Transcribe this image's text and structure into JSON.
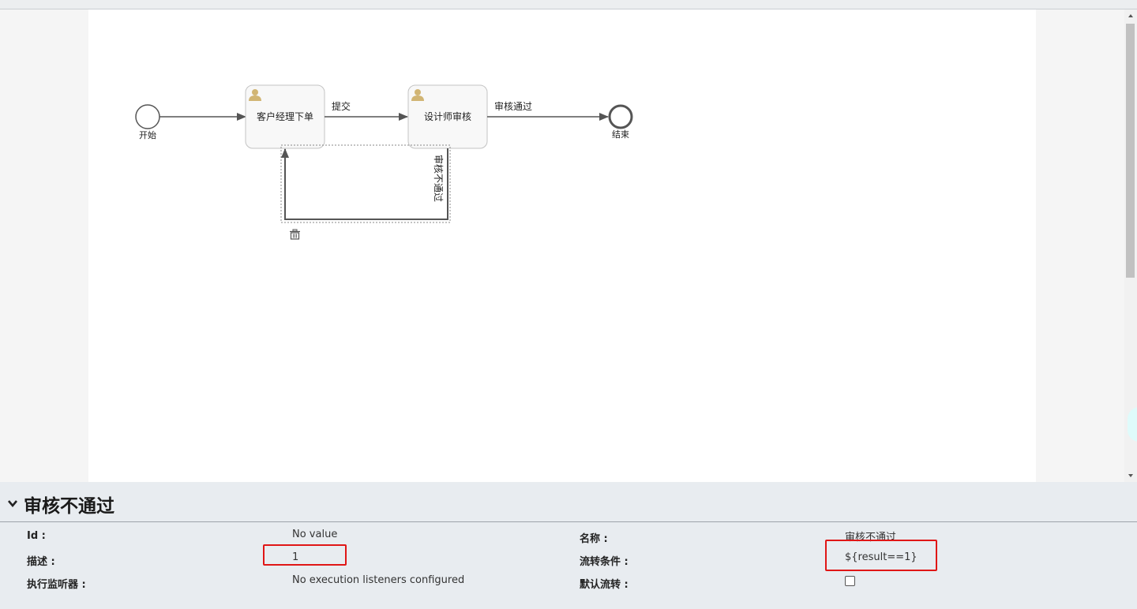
{
  "diagram": {
    "start_event_label": "开始",
    "end_event_label": "结束",
    "tasks": [
      {
        "label": "客户经理下单",
        "icon": "user-icon"
      },
      {
        "label": "设计师审核",
        "icon": "user-icon"
      }
    ],
    "flows": {
      "submit": "提交",
      "approve": "审核通过",
      "reject": "审核不通过"
    },
    "selected_flow": "审核不通过",
    "delete_icon": "trash-icon"
  },
  "panel": {
    "title": "审核不通过",
    "chevron_icon": "chevron-down-icon",
    "properties": {
      "id_label": "Id :",
      "id_value": "No value",
      "name_label": "名称 :",
      "name_value": "审核不通过",
      "description_label": "描述 :",
      "description_value": "1",
      "condition_label": "流转条件 :",
      "condition_value": "${result==1}",
      "listeners_label": "执行监听器 :",
      "listeners_value": "No execution listeners configured",
      "default_flow_label": "默认流转 :",
      "default_flow_checked": false
    }
  },
  "colors": {
    "highlight_red": "#e01616",
    "task_fill": "#f8f8f8",
    "user_icon": "#d1b574",
    "panel_bg": "#e8ecf0"
  }
}
